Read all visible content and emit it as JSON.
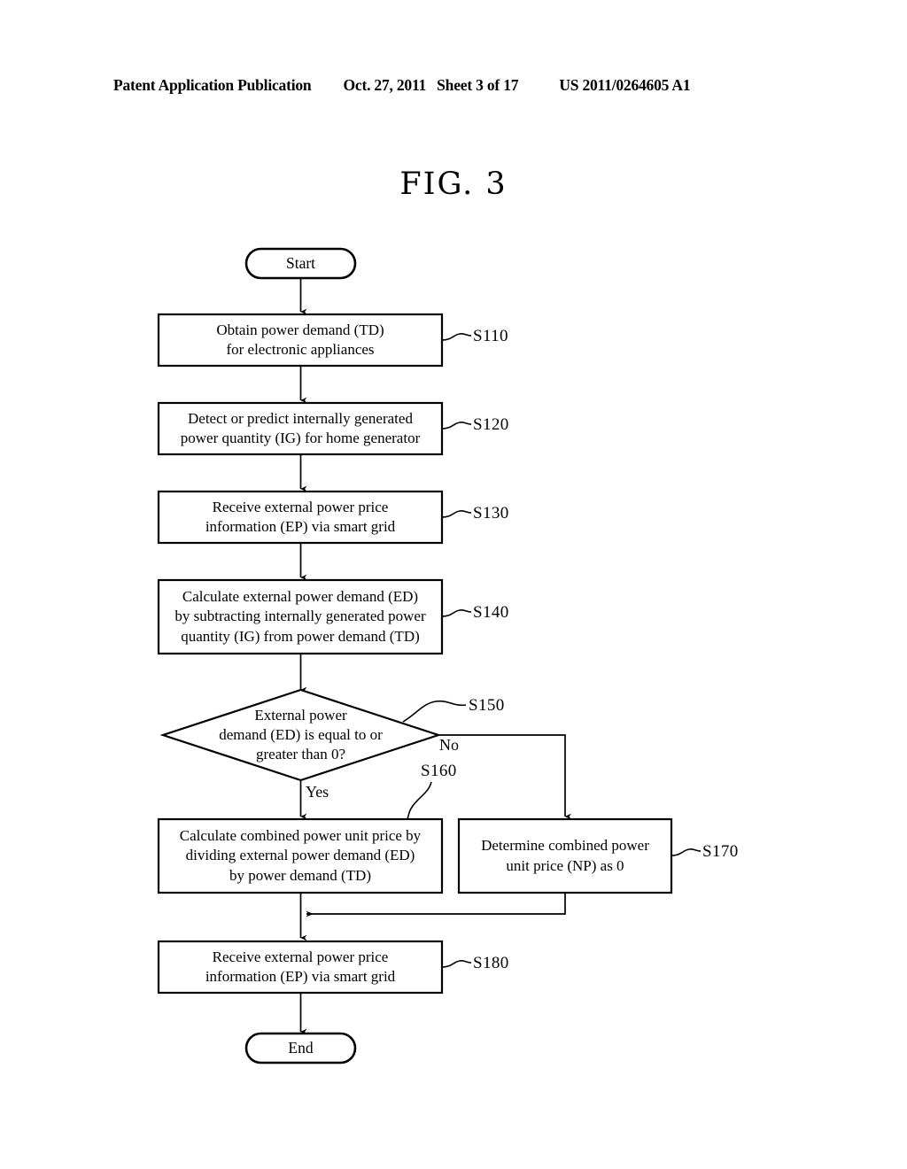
{
  "header": {
    "publication": "Patent Application Publication",
    "date": "Oct. 27, 2011",
    "sheet": "Sheet 3 of 17",
    "patent_number": "US 2011/0264605 A1"
  },
  "figure": {
    "title": "FIG. 3"
  },
  "flowchart": {
    "start": {
      "label": "Start"
    },
    "end": {
      "label": "End"
    },
    "steps": [
      {
        "id": "S110",
        "text": "Obtain power demand (TD)\nfor electronic appliances",
        "ref": "S110"
      },
      {
        "id": "S120",
        "text": "Detect or predict internally generated\npower quantity (IG) for home generator",
        "ref": "S120"
      },
      {
        "id": "S130",
        "text": "Receive external power price\ninformation (EP) via smart grid",
        "ref": "S130"
      },
      {
        "id": "S140",
        "text": "Calculate external power demand (ED)\nby subtracting internally generated power\nquantity (IG) from power demand (TD)",
        "ref": "S140"
      },
      {
        "id": "S150",
        "text": "External power\ndemand (ED) is equal to or\ngreater than 0?",
        "ref": "S150"
      },
      {
        "id": "S160",
        "text": "Calculate combined power unit price by\ndividing external power demand (ED)\nby power demand (TD)",
        "ref": "S160"
      },
      {
        "id": "S170",
        "text": "Determine combined power\nunit price (NP) as 0",
        "ref": "S170"
      },
      {
        "id": "S180",
        "text": "Receive external power price\ninformation (EP) via smart grid",
        "ref": "S180"
      }
    ],
    "branches": {
      "yes": "Yes",
      "no": "No"
    }
  },
  "style": {
    "line_color": "#000000",
    "background": "#ffffff"
  }
}
